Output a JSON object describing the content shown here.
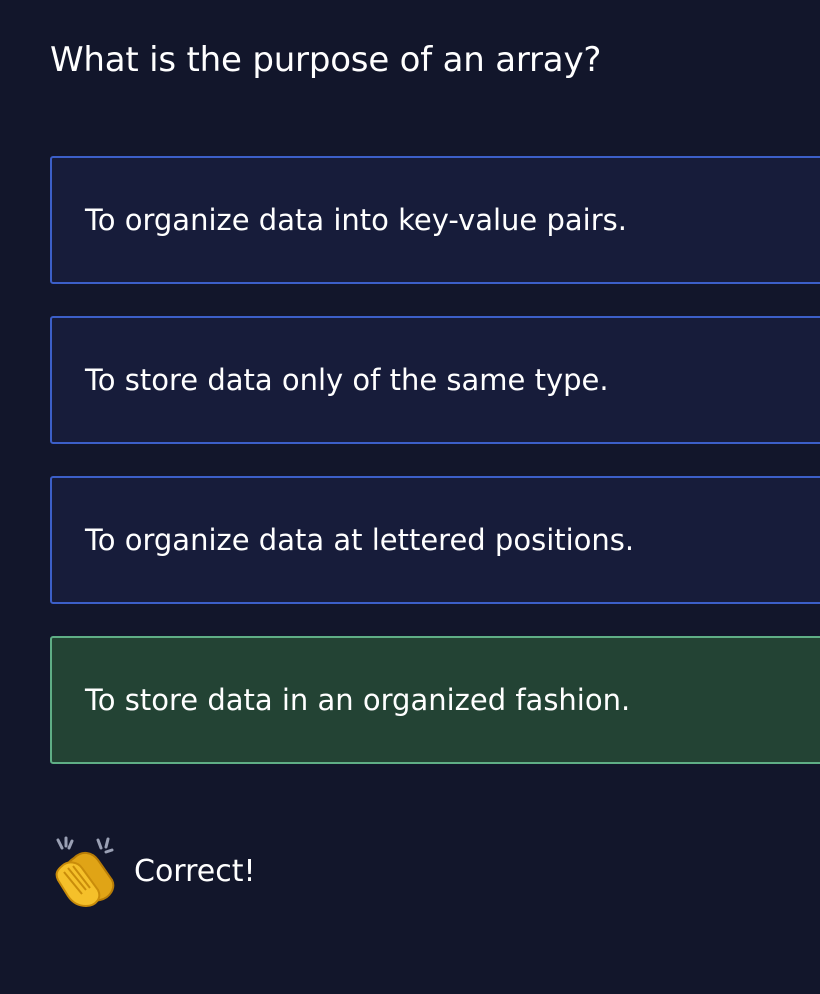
{
  "question": {
    "text": "What is the purpose of an array?"
  },
  "options": [
    {
      "label": "To organize data into key-value pairs.",
      "state": "default"
    },
    {
      "label": "To store data only of the same type.",
      "state": "default"
    },
    {
      "label": "To organize data at lettered positions.",
      "state": "default"
    },
    {
      "label": "To store data in an organized fashion.",
      "state": "correct"
    }
  ],
  "feedback": {
    "icon": "clapping-hands-icon",
    "text": "Correct!"
  },
  "colors": {
    "background": "#12162b",
    "option_background": "#171c3a",
    "option_border": "#3c5fc8",
    "correct_background": "#234334",
    "correct_border": "#5fae86"
  }
}
